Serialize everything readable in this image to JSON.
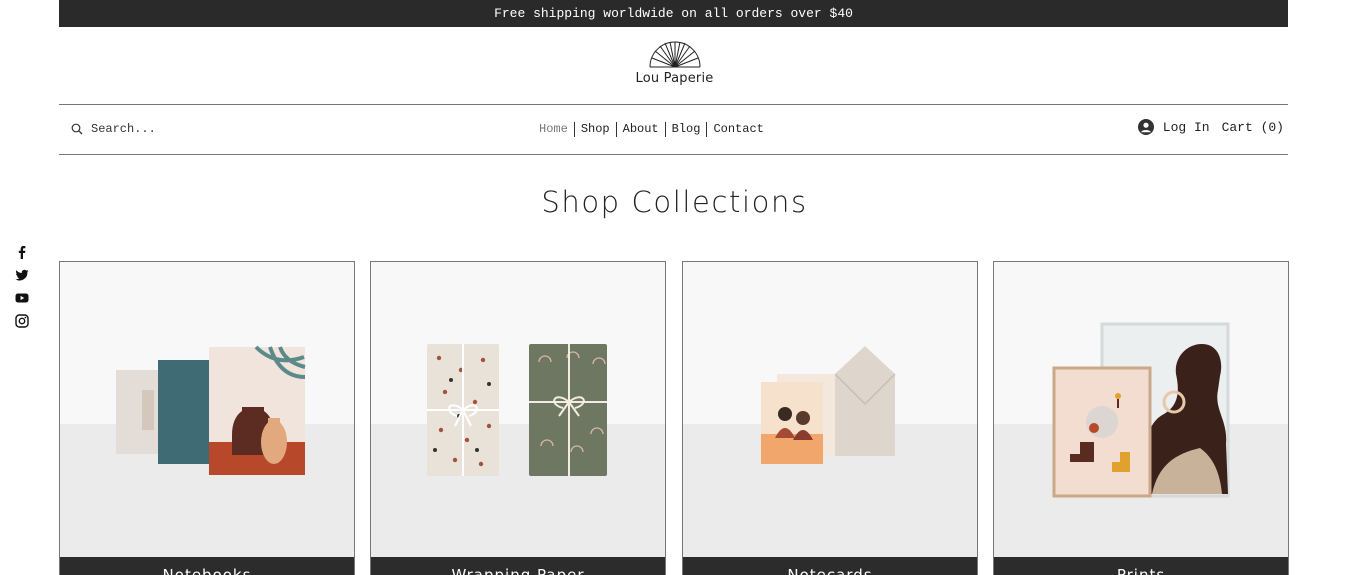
{
  "announcement": "Free shipping worldwide on all orders over $40",
  "brand": {
    "name": "Lou Paperie"
  },
  "search": {
    "placeholder": "Search..."
  },
  "nav": {
    "items": [
      "Home",
      "Shop",
      "About",
      "Blog",
      "Contact"
    ],
    "active": "Home"
  },
  "account": {
    "login_label": "Log In",
    "cart_label": "Cart (0)"
  },
  "social": [
    "facebook-icon",
    "twitter-icon",
    "youtube-icon",
    "instagram-icon"
  ],
  "main": {
    "heading": "Shop Collections",
    "collections": [
      {
        "label": "Notebooks",
        "image": "notebooks-image"
      },
      {
        "label": "Wrapping Paper",
        "image": "wrapping-paper-image"
      },
      {
        "label": "Notecards",
        "image": "notecards-image"
      },
      {
        "label": "Prints",
        "image": "prints-image"
      }
    ]
  },
  "colors": {
    "announcement_bg": "#2a2a2a",
    "card_label_bg": "#2c2c2c",
    "text": "#222222"
  }
}
